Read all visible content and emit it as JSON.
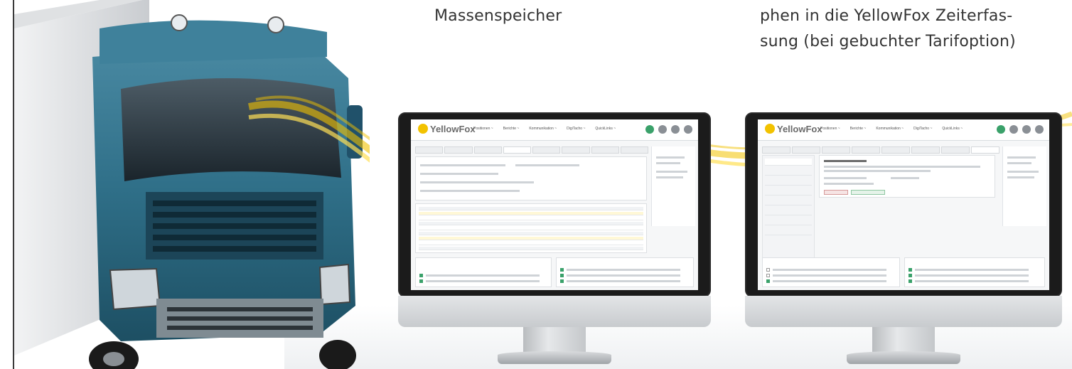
{
  "captions": {
    "middle": "Massenspeicher",
    "right_lines": [
      "phen in die YellowFox Zeiterfas-",
      "sung (bei gebuchter Tarifoption)"
    ]
  },
  "app": {
    "logo": "YellowFox",
    "menu": [
      "Positionen ~",
      "Berichte ~",
      "Kommunikation ~",
      "DigiTacho ~",
      "QuickLinks ~"
    ]
  },
  "colors": {
    "accent": "#f2c200",
    "truck_blue": "#2f6f88",
    "success": "#3aa16a"
  },
  "icons": [
    "truck-image",
    "yellow-data-stream",
    "monitor",
    "settings-icon",
    "user-icon"
  ]
}
